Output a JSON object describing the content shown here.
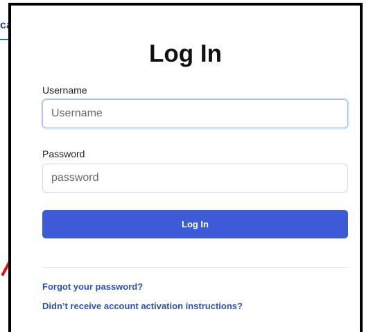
{
  "background": {
    "fragment_text": "ca"
  },
  "modal": {
    "title": "Log In",
    "username": {
      "label": "Username",
      "value": "",
      "placeholder": "Username"
    },
    "password": {
      "label": "Password",
      "value": "",
      "placeholder": "password"
    },
    "submit_label": "Log In",
    "links": {
      "forgot_password": "Forgot your password?",
      "activation": "Didn’t receive account activation instructions?"
    }
  },
  "colors": {
    "primary_button": "#3d5bd9",
    "link": "#2a52be",
    "annotation_arrow": "#e01010"
  },
  "icons": {
    "annotation": "red-arrow-icon"
  }
}
